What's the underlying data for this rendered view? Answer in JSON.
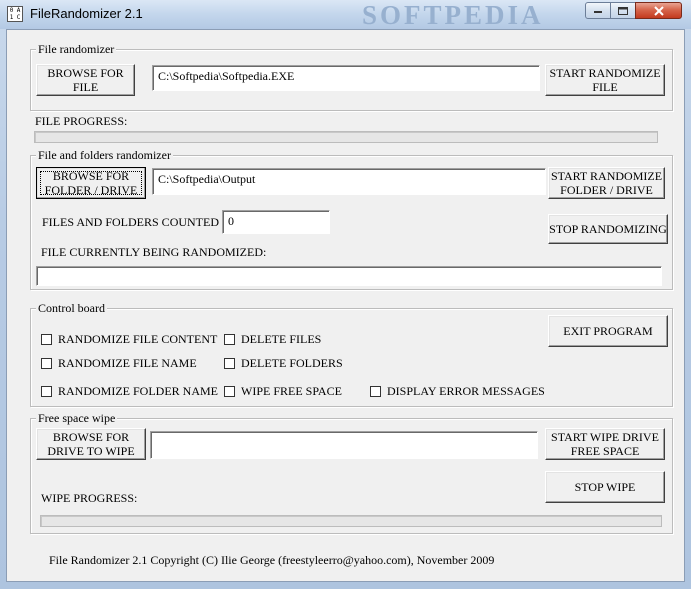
{
  "window": {
    "title": "FileRandomizer 2.1",
    "watermark": "SOFTPEDIA",
    "icon_glyphs": [
      "0",
      "A",
      "1",
      "C"
    ]
  },
  "file_randomizer": {
    "group_title": "File randomizer",
    "browse_label_l1": "BROWSE FOR",
    "browse_label_l2": "FILE",
    "path_value": "C:\\Softpedia\\Softpedia.EXE",
    "start_label_l1": "START RANDOMIZE",
    "start_label_l2": "FILE",
    "progress_label": "FILE PROGRESS:",
    "progress_value": 0
  },
  "folders_randomizer": {
    "group_title": "File and folders randomizer",
    "browse_label_l1": "BROWSE FOR",
    "browse_label_l2": "FOLDER / DRIVE",
    "path_value": "C:\\Softpedia\\Output",
    "start_label_l1": "START RANDOMIZE",
    "start_label_l2": "FOLDER / DRIVE",
    "counted_label": "FILES AND FOLDERS COUNTED :",
    "counted_value": "0",
    "stop_label": "STOP RANDOMIZING",
    "current_label": "FILE CURRENTLY BEING RANDOMIZED:",
    "current_value": ""
  },
  "control_board": {
    "group_title": "Control board",
    "checkboxes": [
      {
        "label": "RANDOMIZE FILE CONTENT",
        "checked": false
      },
      {
        "label": "RANDOMIZE FILE NAME",
        "checked": false
      },
      {
        "label": "RANDOMIZE FOLDER NAME",
        "checked": false
      },
      {
        "label": "DELETE FILES",
        "checked": false
      },
      {
        "label": "DELETE  FOLDERS",
        "checked": false
      },
      {
        "label": "WIPE FREE SPACE",
        "checked": false
      },
      {
        "label": "DISPLAY ERROR MESSAGES",
        "checked": false
      }
    ],
    "exit_label": "EXIT PROGRAM"
  },
  "free_space_wipe": {
    "group_title": "Free space wipe",
    "browse_label_l1": "BROWSE FOR",
    "browse_label_l2": "DRIVE TO WIPE",
    "drive_value": "",
    "start_label_l1": "START WIPE DRIVE",
    "start_label_l2": "FREE SPACE",
    "stop_label": "STOP WIPE",
    "progress_label": "WIPE PROGRESS:",
    "progress_value": 0
  },
  "footer": {
    "copyright": "File Randomizer 2.1 Copyright (C) Ilie George (freestyleerro@yahoo.com), November 2009"
  }
}
